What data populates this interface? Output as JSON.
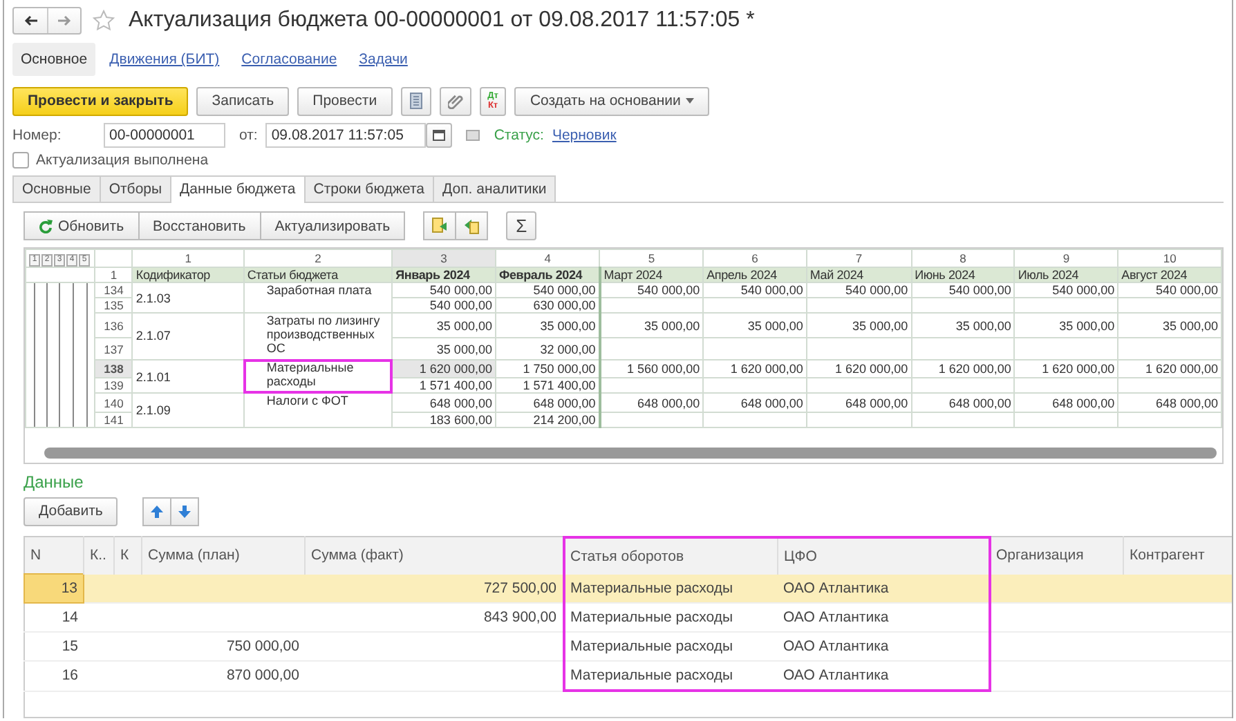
{
  "window": {
    "title": "Актуализация бюджета 00-00000001 от 09.08.2017 11:57:05 *"
  },
  "sections": [
    {
      "label": "Основное",
      "selected": true
    },
    {
      "label": "Движения (БИТ)",
      "selected": false
    },
    {
      "label": "Согласование",
      "selected": false
    },
    {
      "label": "Задачи",
      "selected": false
    }
  ],
  "toolbar": [
    {
      "kind": "primary",
      "label": "Провести и закрыть"
    },
    {
      "kind": "plain",
      "label": "Записать"
    },
    {
      "kind": "plain",
      "label": "Провести"
    },
    {
      "kind": "list"
    },
    {
      "kind": "clip"
    },
    {
      "kind": "ledger",
      "labels": [
        "Дт",
        "Кт"
      ]
    },
    {
      "kind": "dropdown",
      "label": "Создать на основании"
    }
  ],
  "fields": {
    "number_label": "Номер:",
    "number": "00-00000001",
    "date_label": "от:",
    "date": "09.08.2017 11:57:05",
    "status_label": "Статус:",
    "status": "Черновик"
  },
  "done": {
    "label": "Актуализация выполнена",
    "checked": false
  },
  "tabs": [
    {
      "label": "Основные",
      "selected": false
    },
    {
      "label": "Отборы",
      "selected": false
    },
    {
      "label": "Данные бюджета",
      "selected": true
    },
    {
      "label": "Строки бюджета",
      "selected": false
    },
    {
      "label": "Доп. аналитики",
      "selected": false
    }
  ],
  "actions": {
    "buttons": [
      "Обновить",
      "Восстановить",
      "Актуализировать"
    ],
    "sum": "Σ"
  },
  "spreadsheet": {
    "levels": [
      "1",
      "2",
      "3",
      "4",
      "5"
    ],
    "header_row_number": "1",
    "columns": [
      {
        "number": "1",
        "title": "Кодификатор",
        "bold": false,
        "selected": false
      },
      {
        "number": "2",
        "title": "Статьи бюджета",
        "bold": false,
        "selected": false
      },
      {
        "number": "3",
        "title": "Январь 2024",
        "bold": true,
        "selected": true
      },
      {
        "number": "4",
        "title": "Февраль 2024",
        "bold": true,
        "selected": false
      },
      {
        "number": "5",
        "title": "Март 2024",
        "bold": false,
        "selected": false
      },
      {
        "number": "6",
        "title": "Апрель 2024",
        "bold": false,
        "selected": false
      },
      {
        "number": "7",
        "title": "Май 2024",
        "bold": false,
        "selected": false
      },
      {
        "number": "8",
        "title": "Июнь 2024",
        "bold": false,
        "selected": false
      },
      {
        "number": "9",
        "title": "Июль 2024",
        "bold": false,
        "selected": false
      },
      {
        "number": "10",
        "title": "Август 2024",
        "bold": false,
        "selected": false
      }
    ],
    "groups": [
      {
        "code": "2.1.03",
        "article": "Заработная плата",
        "highlighted": false,
        "rows": [
          {
            "number": "134",
            "selected": false,
            "values": [
              "540 000,00",
              "540 000,00",
              "540 000,00",
              "540 000,00",
              "540 000,00",
              "540 000,00",
              "540 000,00",
              "540 000,00"
            ]
          },
          {
            "number": "135",
            "selected": false,
            "values": [
              "540 000,00",
              "630 000,00"
            ]
          }
        ]
      },
      {
        "code": "2.1.07",
        "article": "Затраты по лизингу производственных ОС",
        "highlighted": false,
        "rows": [
          {
            "number": "136",
            "selected": false,
            "values": [
              "35 000,00",
              "35 000,00",
              "35 000,00",
              "35 000,00",
              "35 000,00",
              "35 000,00",
              "35 000,00",
              "35 000,00"
            ]
          },
          {
            "number": "137",
            "selected": false,
            "values": [
              "35 000,00",
              "32 000,00"
            ]
          }
        ]
      },
      {
        "code": "2.1.01",
        "article": "Материальные расходы",
        "highlighted": true,
        "rows": [
          {
            "number": "138",
            "selected": true,
            "values": [
              "1 620 000,00",
              "1 750 000,00",
              "1 560 000,00",
              "1 620 000,00",
              "1 620 000,00",
              "1 620 000,00",
              "1 620 000,00",
              "1 620 000,00"
            ]
          },
          {
            "number": "139",
            "selected": false,
            "values": [
              "1 571 400,00",
              "1 571 400,00"
            ]
          }
        ]
      },
      {
        "code": "2.1.09",
        "article": "Налоги с ФОТ",
        "highlighted": false,
        "rows": [
          {
            "number": "140",
            "selected": false,
            "values": [
              "648 000,00",
              "648 000,00",
              "648 000,00",
              "648 000,00",
              "648 000,00",
              "648 000,00",
              "648 000,00",
              "648 000,00"
            ]
          },
          {
            "number": "141",
            "selected": false,
            "values": [
              "183 600,00",
              "214 200,00"
            ]
          }
        ]
      }
    ]
  },
  "data_section": {
    "title": "Данные",
    "add": "Добавить"
  },
  "table": {
    "columns": [
      {
        "title": "N",
        "highlighted": false
      },
      {
        "title": "К..",
        "highlighted": false
      },
      {
        "title": "К",
        "highlighted": false
      },
      {
        "title": "Сумма (план)",
        "highlighted": false
      },
      {
        "title": "Сумма (факт)",
        "highlighted": false
      },
      {
        "title": "Статья оборотов",
        "highlighted": true
      },
      {
        "title": "ЦФО",
        "highlighted": true
      },
      {
        "title": "Организация",
        "highlighted": false
      },
      {
        "title": "Контрагент",
        "highlighted": false
      }
    ],
    "rows": [
      {
        "selected": true,
        "n": "13",
        "sum_fact": "727 500,00",
        "article": "Материальные расходы",
        "cfo": "ОАО Атлантика"
      },
      {
        "selected": false,
        "n": "14",
        "sum_fact": "843 900,00",
        "article": "Материальные расходы",
        "cfo": "ОАО Атлантика"
      },
      {
        "selected": false,
        "n": "15",
        "sum_plan": "750 000,00",
        "article": "Материальные расходы",
        "cfo": "ОАО Атлантика"
      },
      {
        "selected": false,
        "n": "16",
        "sum_plan": "870 000,00",
        "article": "Материальные расходы",
        "cfo": "ОАО Атлантика"
      }
    ]
  }
}
